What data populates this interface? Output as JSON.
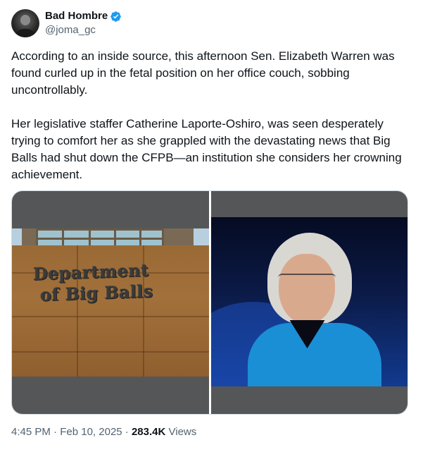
{
  "author": {
    "display_name": "Bad Hombre",
    "handle": "@joma_gc",
    "verified": true,
    "avatar_icon": "profile-avatar"
  },
  "tweet": {
    "paragraphs": [
      "According to an inside source, this afternoon Sen. Elizabeth Warren was found curled up in the fetal position on her office couch, sobbing uncontrollably.",
      "Her legislative staffer Catherine Laporte-Oshiro, was seen desperately trying to comfort her as she grappled with the devastating news that Big Balls had shut down the CFPB—an institution she considers her crowning achievement."
    ]
  },
  "media": {
    "left_image": {
      "sign_line1": "Department",
      "sign_line2": "of Big Balls"
    },
    "right_image": {
      "subject": "portrait-photo"
    }
  },
  "meta": {
    "time": "4:45 PM",
    "separator": "·",
    "date": "Feb 10, 2025",
    "views_count": "283.4K",
    "views_label": "Views"
  },
  "colors": {
    "verified_blue": "#1d9bf0",
    "text_primary": "#0f1419",
    "text_secondary": "#536471",
    "border": "#cfd9de"
  }
}
